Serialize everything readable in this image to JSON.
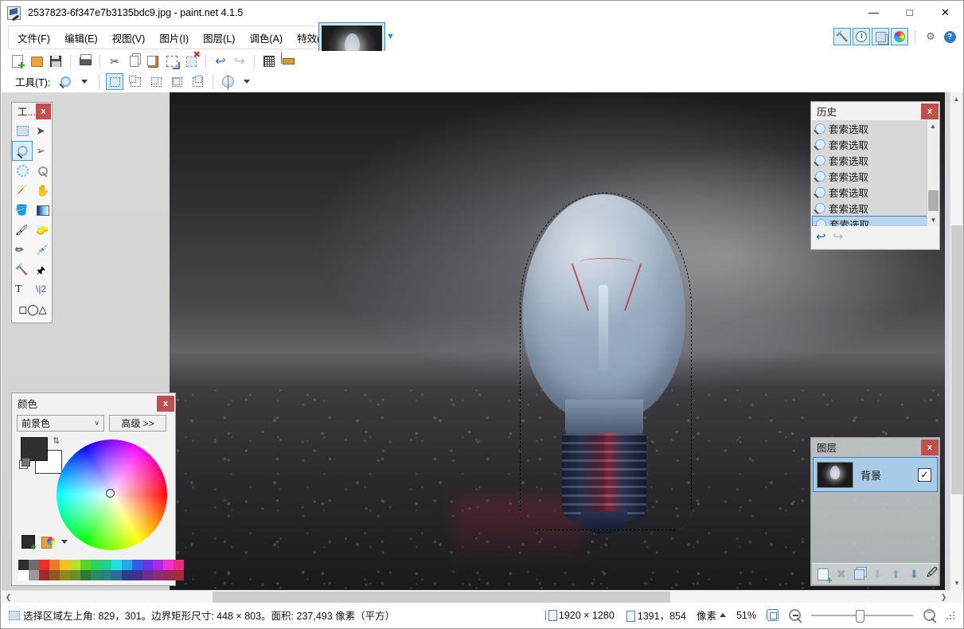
{
  "window": {
    "title": "2537823-6f347e7b3135bdc9.jpg - paint.net 4.1.5",
    "app_icon": "paintnet-icon",
    "minimize": "—",
    "maximize": "□",
    "close": "✕"
  },
  "menu": {
    "items": [
      {
        "label": "文件(F)",
        "name": "menu-file"
      },
      {
        "label": "编辑(E)",
        "name": "menu-edit"
      },
      {
        "label": "视图(V)",
        "name": "menu-view"
      },
      {
        "label": "图片(I)",
        "name": "menu-image"
      },
      {
        "label": "图层(L)",
        "name": "menu-layers"
      },
      {
        "label": "调色(A)",
        "name": "menu-adjustments"
      },
      {
        "label": "特效(C)",
        "name": "menu-effects"
      }
    ]
  },
  "toolbar": {
    "buttons": [
      {
        "name": "new-button",
        "icon": "new-file-icon"
      },
      {
        "name": "open-button",
        "icon": "open-folder-icon"
      },
      {
        "name": "save-button",
        "icon": "save-disk-icon"
      },
      {
        "name": "print-button",
        "icon": "print-icon"
      },
      {
        "name": "cut-button",
        "icon": "scissors-icon"
      },
      {
        "name": "copy-button",
        "icon": "copy-icon"
      },
      {
        "name": "paste-button",
        "icon": "paste-icon"
      },
      {
        "name": "crop-to-selection-button",
        "icon": "crop-icon"
      },
      {
        "name": "deselect-all-button",
        "icon": "deselect-icon"
      },
      {
        "name": "undo-button",
        "icon": "undo-arrow-icon"
      },
      {
        "name": "redo-button",
        "icon": "redo-arrow-icon"
      },
      {
        "name": "pixel-grid-button",
        "icon": "grid-icon"
      },
      {
        "name": "rulers-button",
        "icon": "ruler-icon"
      }
    ]
  },
  "toolbar2": {
    "tools_label": "工具(T):",
    "active_tool_icon": "magnifier-lasso-icon",
    "selection_modes": [
      {
        "name": "selection-mode-replace",
        "active": true
      },
      {
        "name": "selection-mode-union",
        "active": false
      },
      {
        "name": "selection-mode-exclude",
        "active": false
      },
      {
        "name": "selection-mode-xor",
        "active": false
      },
      {
        "name": "selection-mode-intersect",
        "active": false
      }
    ],
    "antialias_icon": "antialiasing-globe-icon"
  },
  "quick_toggles": [
    {
      "name": "toggle-tools-window",
      "icon": "hammer-icon",
      "on": true
    },
    {
      "name": "toggle-history-window",
      "icon": "clock-icon",
      "on": true
    },
    {
      "name": "toggle-layers-window",
      "icon": "layers-icon",
      "on": true
    },
    {
      "name": "toggle-colors-window",
      "icon": "color-wheel-icon",
      "on": true
    },
    {
      "name": "settings-button",
      "icon": "gear-icon",
      "on": false
    },
    {
      "name": "help-button",
      "icon": "help-question-icon",
      "on": false
    }
  ],
  "tools_panel": {
    "title": "工...",
    "close": "x",
    "tools": [
      {
        "name": "tool-rectangle-select",
        "icon": "rectangle-select-icon",
        "glyph": "",
        "cls": "ti-rectselect",
        "active": false
      },
      {
        "name": "tool-move-selected",
        "icon": "move-selected-icon",
        "glyph": "➤",
        "cls": "ti-move",
        "active": false
      },
      {
        "name": "tool-lasso-select",
        "icon": "lasso-select-icon",
        "glyph": "",
        "cls": "ti-lasso",
        "active": true
      },
      {
        "name": "tool-move-selection",
        "icon": "move-selection-icon",
        "glyph": "➢",
        "cls": "ti-moveseln",
        "active": false
      },
      {
        "name": "tool-ellipse-select",
        "icon": "ellipse-select-icon",
        "glyph": "",
        "cls": "ti-ellipse",
        "active": false
      },
      {
        "name": "tool-zoom",
        "icon": "zoom-magnifier-icon",
        "glyph": "",
        "cls": "ti-zoom",
        "active": false
      },
      {
        "name": "tool-magic-wand",
        "icon": "magic-wand-icon",
        "glyph": "🪄",
        "cls": "ti-wand",
        "active": false
      },
      {
        "name": "tool-pan",
        "icon": "pan-hand-icon",
        "glyph": "✋",
        "cls": "ti-pan",
        "active": false
      },
      {
        "name": "tool-paint-bucket",
        "icon": "paint-bucket-icon",
        "glyph": "🪣",
        "cls": "ti-bucket",
        "active": false
      },
      {
        "name": "tool-gradient",
        "icon": "gradient-icon",
        "glyph": "",
        "cls": "ti-gradient",
        "active": false
      },
      {
        "name": "tool-paintbrush",
        "icon": "paintbrush-icon",
        "glyph": "🖌",
        "cls": "ti-brush",
        "active": false
      },
      {
        "name": "tool-eraser",
        "icon": "eraser-icon",
        "glyph": "🧽",
        "cls": "ti-eraser",
        "active": false
      },
      {
        "name": "tool-pencil",
        "icon": "pencil-icon",
        "glyph": "✏",
        "cls": "ti-pencil",
        "active": false
      },
      {
        "name": "tool-color-picker",
        "icon": "eyedropper-icon",
        "glyph": "💉",
        "cls": "ti-picker",
        "active": false
      },
      {
        "name": "tool-clone-stamp",
        "icon": "clone-stamp-icon",
        "glyph": "🔨",
        "cls": "ti-clone",
        "active": false
      },
      {
        "name": "tool-recolor",
        "icon": "recolor-icon",
        "glyph": "🖈",
        "cls": "ti-recolor",
        "active": false
      },
      {
        "name": "tool-text",
        "icon": "text-icon",
        "glyph": "T",
        "cls": "ti-text",
        "active": false
      },
      {
        "name": "tool-line-curve",
        "icon": "line-curve-icon",
        "glyph": "\\|2",
        "cls": "ti-line",
        "active": false
      },
      {
        "name": "tool-shapes",
        "icon": "shapes-icon",
        "glyph": "◻◯△",
        "cls": "ti-shapes",
        "active": false
      }
    ]
  },
  "colors_panel": {
    "title": "颜色",
    "close": "x",
    "mode_label": "前景色",
    "advanced_label": "高级 >>",
    "primary_color": "#303030",
    "secondary_color": "#ffffff",
    "palette_row1": [
      "#2e2e2e",
      "#6b6b6b",
      "#f42a2a",
      "#f07828",
      "#f4c21e",
      "#b7e02a",
      "#55d52c",
      "#2ad45a",
      "#22cf8e",
      "#1fe0e0",
      "#2aa6ec",
      "#2a5fe8",
      "#6a34e6",
      "#a92ae6",
      "#ee2fd2",
      "#f02a7a"
    ],
    "palette_row2": [
      "#ffffff",
      "#9b9b9b",
      "#a02b2b",
      "#8c5a24",
      "#93861f",
      "#6a8f2a",
      "#2f7a35",
      "#2a8a63",
      "#2d7f86",
      "#2f6a94",
      "#273f86",
      "#43318f",
      "#6b2f8c",
      "#8c2d78",
      "#99295a",
      "#a02b3c"
    ]
  },
  "history_panel": {
    "title": "历史",
    "close": "x",
    "items": [
      {
        "label": "套索选取",
        "selected": false
      },
      {
        "label": "套索选取",
        "selected": false
      },
      {
        "label": "套索选取",
        "selected": false
      },
      {
        "label": "套索选取",
        "selected": false
      },
      {
        "label": "套索选取",
        "selected": false
      },
      {
        "label": "套索选取",
        "selected": false
      },
      {
        "label": "套索选取",
        "selected": true
      }
    ],
    "undo_icon": "undo-arrow-icon",
    "redo_icon": "redo-arrow-icon"
  },
  "layers_panel": {
    "title": "图层",
    "close": "x",
    "layers": [
      {
        "name": "背景",
        "visible": true,
        "checkmark": "✓",
        "selected": true
      }
    ],
    "footer_buttons": [
      {
        "name": "add-layer-button",
        "icon": "add-layer-icon"
      },
      {
        "name": "delete-layer-button",
        "icon": "delete-layer-icon"
      },
      {
        "name": "duplicate-layer-button",
        "icon": "duplicate-layer-icon"
      },
      {
        "name": "merge-layer-down-button",
        "icon": "merge-down-icon"
      },
      {
        "name": "move-layer-up-button",
        "icon": "arrow-up-icon"
      },
      {
        "name": "move-layer-down-button",
        "icon": "arrow-down-icon"
      },
      {
        "name": "layer-properties-button",
        "icon": "layer-properties-icon"
      }
    ]
  },
  "statusbar": {
    "selection_info": "选择区域左上角: 829，301。边界矩形尺寸: 448 × 803。面积: 237,493 像素（平方）",
    "image_size": "1920 × 1280",
    "cursor_position": "1391，854",
    "units": "像素",
    "zoom_level": "51%",
    "icons": {
      "selection": "selection-icon",
      "image_size": "image-size-icon",
      "cursor": "cursor-position-icon",
      "fit_window": "fit-to-window-icon",
      "zoom_out": "zoom-out-icon",
      "zoom_in": "zoom-in-icon"
    }
  },
  "canvas": {
    "document_tab_name": "image-thumbnail-tab",
    "selection_outline": "marching-ants-selection"
  }
}
